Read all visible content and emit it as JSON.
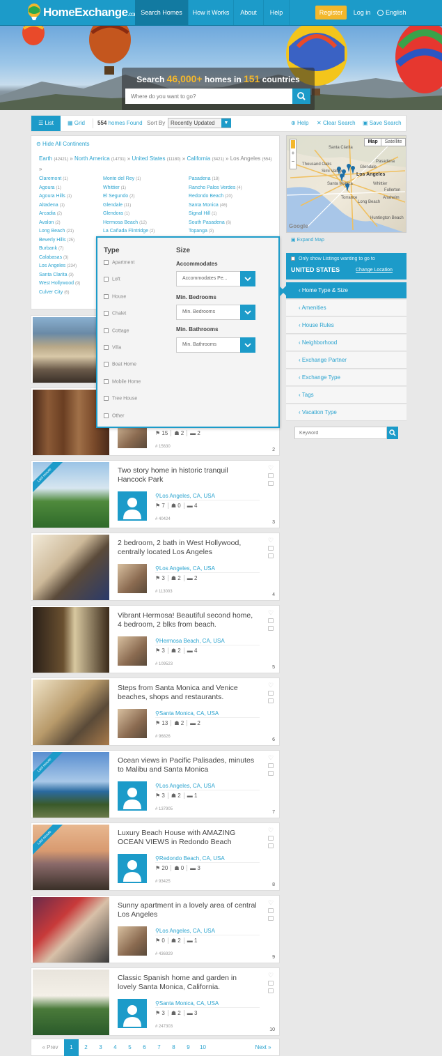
{
  "brand": {
    "name": "HomeExchange",
    "suffix": ".com"
  },
  "nav": {
    "items": [
      "Search Homes",
      "How it Works",
      "About",
      "Help"
    ],
    "register": "Register",
    "login": "Log in",
    "language": "English"
  },
  "hero": {
    "title_pre": "Search ",
    "homes": "46,000+",
    "title_mid": " homes in ",
    "countries": "151",
    "title_post": " countries",
    "placeholder": "Where do you want to go?"
  },
  "toolbar": {
    "list": "List",
    "grid": "Grid",
    "count": "554",
    "found": "homes Found",
    "sort_by": "Sort By",
    "sort_value": "Recently Updated",
    "help": "Help",
    "clear": "Clear Search",
    "save": "Save Search"
  },
  "breadcrumb": {
    "hide": "Hide All Continents",
    "earth": "Earth",
    "earth_n": "(42421)",
    "na": "North America",
    "na_n": "(14731)",
    "us": "United States",
    "us_n": "(11180)",
    "ca": "California",
    "ca_n": "(3421)",
    "la": "Los Angeles",
    "la_n": "(554)"
  },
  "cities": {
    "col1": [
      {
        "name": "Claremont",
        "n": "(1)"
      },
      {
        "name": "Agoura",
        "n": "(1)"
      },
      {
        "name": "Agoura Hills",
        "n": "(1)"
      },
      {
        "name": "Altadena",
        "n": "(1)"
      },
      {
        "name": "Arcadia",
        "n": "(2)"
      },
      {
        "name": "Avalon",
        "n": "(2)"
      },
      {
        "name": "Long Beach",
        "n": "(21)"
      },
      {
        "name": "Beverly Hills",
        "n": "(25)"
      },
      {
        "name": "Burbank",
        "n": "(7)"
      },
      {
        "name": "Calabasas",
        "n": "(3)"
      },
      {
        "name": "Los Angeles",
        "n": "(234)"
      },
      {
        "name": "Santa Clarita",
        "n": "(3)"
      },
      {
        "name": "West Hollywood",
        "n": "(9)"
      },
      {
        "name": "Culver City",
        "n": "(6)"
      }
    ],
    "col2": [
      {
        "name": "Monte del Rey",
        "n": "(1)"
      },
      {
        "name": "Whittier",
        "n": "(1)"
      },
      {
        "name": "El Segundo",
        "n": "(2)"
      },
      {
        "name": "Glendale",
        "n": "(11)"
      },
      {
        "name": "Glendora",
        "n": "(1)"
      },
      {
        "name": "Hermosa Beach",
        "n": "(12)"
      },
      {
        "name": "La Cañada Flintridge",
        "n": "(2)"
      }
    ],
    "col3": [
      {
        "name": "Pasadena",
        "n": "(18)"
      },
      {
        "name": "Rancho Palos Verdes",
        "n": "(4)"
      },
      {
        "name": "Redondo Beach",
        "n": "(20)"
      },
      {
        "name": "Santa Monica",
        "n": "(46)"
      },
      {
        "name": "Signal Hill",
        "n": "(1)"
      },
      {
        "name": "South Pasadena",
        "n": "(6)"
      },
      {
        "name": "Topanga",
        "n": "(3)"
      }
    ]
  },
  "popup": {
    "type_title": "Type",
    "types": [
      "Apartment",
      "Loft",
      "House",
      "Chalet",
      "Cottage",
      "Villa",
      "Boat Home",
      "Mobile Home",
      "Tree House",
      "Other"
    ],
    "size_title": "Size",
    "acc_label": "Accommodates",
    "acc_value": "Accommodates Pe...",
    "bed_label": "Min. Bedrooms",
    "bed_value": "Min. Bedrooms",
    "bath_label": "Min. Bathrooms",
    "bath_value": "Min. Bathrooms"
  },
  "map": {
    "map_btn": "Map",
    "sat_btn": "Satellite",
    "expand": "Expand Map",
    "labels": [
      "Los Angeles",
      "Glendale",
      "Pasadena",
      "Santa Monica",
      "Torrance",
      "Long Beach",
      "Anaheim",
      "Whittier",
      "Fullerton",
      "Huntington Beach",
      "Thousand Oaks",
      "Simi Valley",
      "Santa Clarita"
    ]
  },
  "sidebar": {
    "only_show": "Only show Listings wanting to go to",
    "country": "UNITED STATES",
    "change": "Change Location",
    "items": [
      "Home Type & Size",
      "Amenities",
      "House Rules",
      "Neighborhood",
      "Exchange Partner",
      "Exchange Type",
      "Tags",
      "Vacation Type"
    ],
    "keyword": "Keyword"
  },
  "listings": [
    {
      "title": "",
      "loc": "",
      "s1": "15",
      "s2": "2",
      "s3": "2",
      "ref": "# 15630",
      "num": "2",
      "lm": false,
      "avatar": "photo"
    },
    {
      "title": "Two story home in historic tranquil Hancock Park",
      "loc": "Los Angeles, CA, USA",
      "s1": "7",
      "s2": "0",
      "s3": "4",
      "ref": "# 40424",
      "num": "3",
      "lm": true,
      "avatar": "default"
    },
    {
      "title": "2 bedroom, 2 bath in West Hollywood, centrally located Los Angeles",
      "loc": "Los Angeles, CA, USA",
      "s1": "3",
      "s2": "2",
      "s3": "2",
      "ref": "# 113003",
      "num": "4",
      "lm": false,
      "avatar": "photo"
    },
    {
      "title": "Vibrant Hermosa! Beautiful second home, 4 bedroom, 2 blks from beach.",
      "loc": "Hermosa Beach, CA, USA",
      "s1": "3",
      "s2": "2",
      "s3": "4",
      "ref": "# 109523",
      "num": "5",
      "lm": false,
      "avatar": "photo"
    },
    {
      "title": "Steps from Santa Monica and Venice beaches, shops and restaurants.",
      "loc": "Santa Monica, CA, USA",
      "s1": "13",
      "s2": "2",
      "s3": "2",
      "ref": "# 96826",
      "num": "6",
      "lm": false,
      "avatar": "photo"
    },
    {
      "title": "Ocean views in Pacific Palisades, minutes to Malibu and Santa Monica",
      "loc": "Los Angeles, CA, USA",
      "s1": "3",
      "s2": "2",
      "s3": "1",
      "ref": "# 137905",
      "num": "7",
      "lm": true,
      "avatar": "default"
    },
    {
      "title": "Luxury Beach House with AMAZING OCEAN VIEWS in Redondo Beach",
      "loc": "Redondo Beach, CA, USA",
      "s1": "20",
      "s2": "0",
      "s3": "3",
      "ref": "# 93425",
      "num": "8",
      "lm": true,
      "avatar": "default"
    },
    {
      "title": "Sunny apartment in a lovely area of central Los Angeles",
      "loc": "Los Angeles, CA, USA",
      "s1": "0",
      "s2": "2",
      "s3": "1",
      "ref": "# 436929",
      "num": "9",
      "lm": false,
      "avatar": "photo"
    },
    {
      "title": "Classic Spanish home and garden in lovely Santa Monica, California.",
      "loc": "Santa Monica, CA, USA",
      "s1": "3",
      "s2": "2",
      "s3": "3",
      "ref": "# 247303",
      "num": "10",
      "lm": false,
      "avatar": "default"
    }
  ],
  "last_minute": "Last minute",
  "pagination": {
    "prev": "« Prev",
    "pages": [
      "1",
      "2",
      "3",
      "4",
      "5",
      "6",
      "7",
      "8",
      "9",
      "10"
    ],
    "next": "Next »"
  },
  "colors": {
    "brand": "#1c9bc9",
    "accent": "#f3b72b",
    "link": "#2aa3cf"
  }
}
